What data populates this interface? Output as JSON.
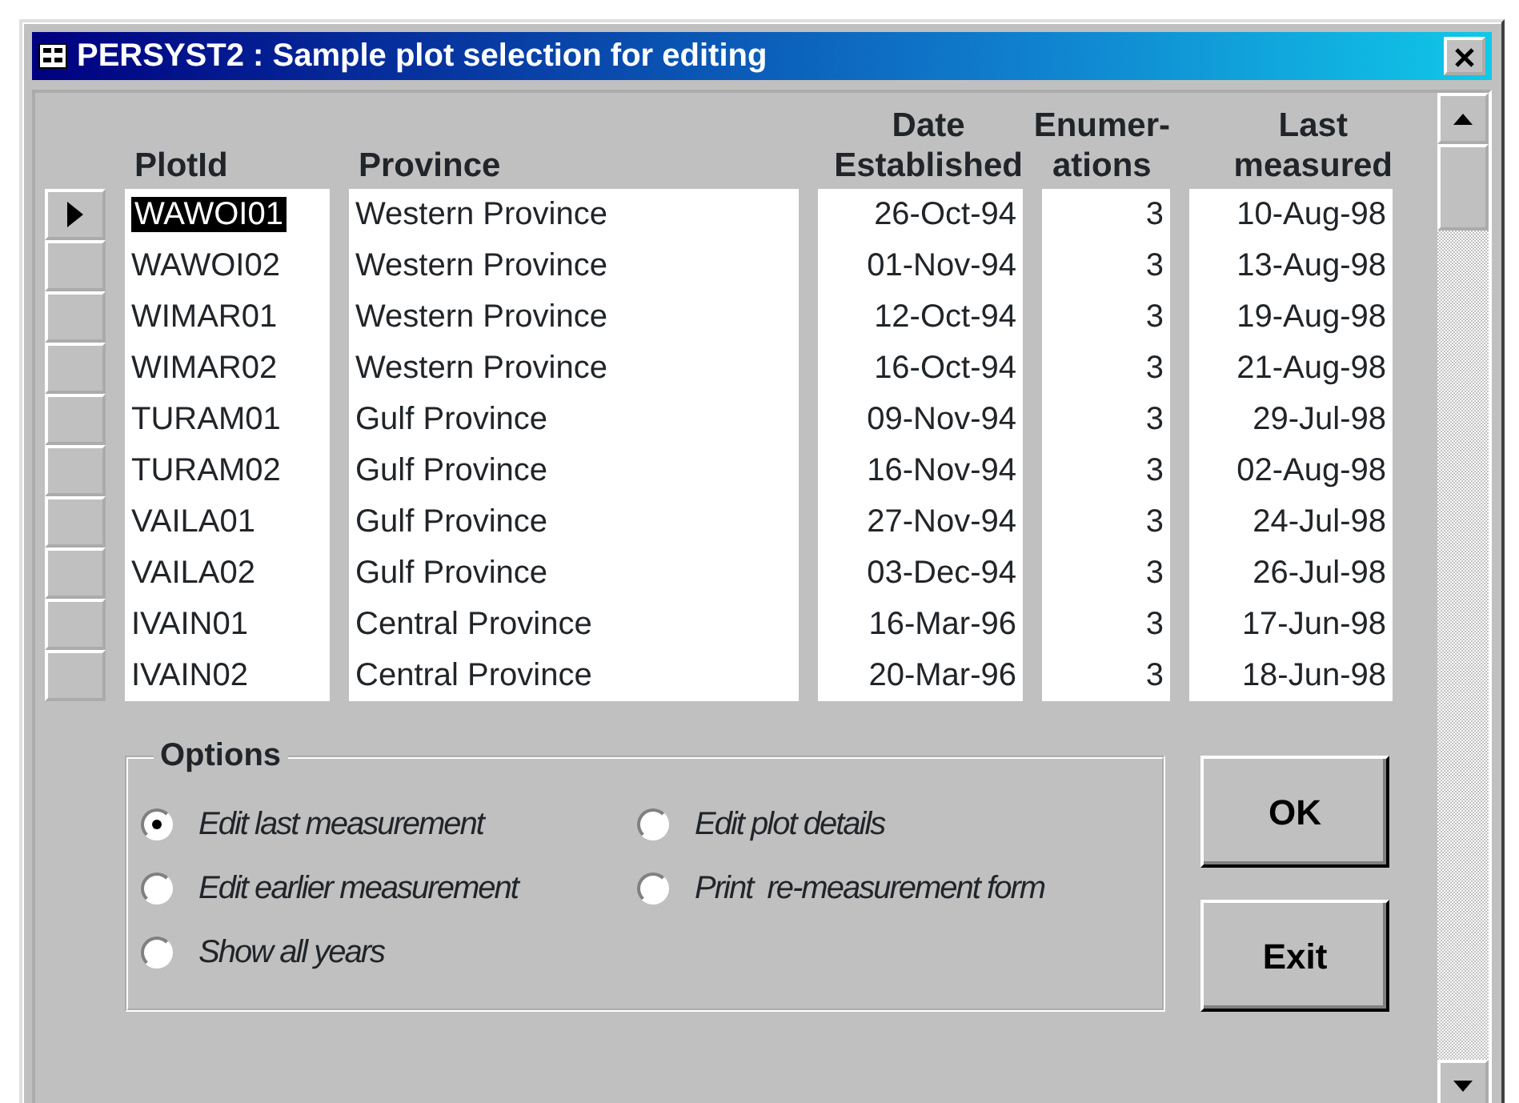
{
  "window": {
    "title": "PERSYST2 : Sample plot selection for editing"
  },
  "table": {
    "columns": [
      {
        "label": "PlotId"
      },
      {
        "label": "Province"
      },
      {
        "label": "Date Established"
      },
      {
        "label": "Enumer- ations"
      },
      {
        "label": "Last measured"
      }
    ],
    "rows": [
      {
        "selected": true,
        "cells": [
          "WAWOI01",
          "Western Province",
          "26-Oct-94",
          "3",
          "10-Aug-98"
        ]
      },
      {
        "selected": false,
        "cells": [
          "WAWOI02",
          "Western Province",
          "01-Nov-94",
          "3",
          "13-Aug-98"
        ]
      },
      {
        "selected": false,
        "cells": [
          "WIMAR01",
          "Western Province",
          "12-Oct-94",
          "3",
          "19-Aug-98"
        ]
      },
      {
        "selected": false,
        "cells": [
          "WIMAR02",
          "Western Province",
          "16-Oct-94",
          "3",
          "21-Aug-98"
        ]
      },
      {
        "selected": false,
        "cells": [
          "TURAM01",
          "Gulf Province",
          "09-Nov-94",
          "3",
          "29-Jul-98"
        ]
      },
      {
        "selected": false,
        "cells": [
          "TURAM02",
          "Gulf Province",
          "16-Nov-94",
          "3",
          "02-Aug-98"
        ]
      },
      {
        "selected": false,
        "cells": [
          "VAILA01",
          "Gulf Province",
          "27-Nov-94",
          "3",
          "24-Jul-98"
        ]
      },
      {
        "selected": false,
        "cells": [
          "VAILA02",
          "Gulf Province",
          "03-Dec-94",
          "3",
          "26-Jul-98"
        ]
      },
      {
        "selected": false,
        "cells": [
          "IVAIN01",
          "Central Province",
          "16-Mar-96",
          "3",
          "17-Jun-98"
        ]
      },
      {
        "selected": false,
        "cells": [
          "IVAIN02",
          "Central Province",
          "20-Mar-96",
          "3",
          "18-Jun-98"
        ]
      }
    ]
  },
  "options": {
    "title": "Options",
    "items": [
      {
        "label": "Edit last measurement",
        "selected": true
      },
      {
        "label": "Edit plot details",
        "selected": false
      },
      {
        "label": "Edit earlier measurement",
        "selected": false
      },
      {
        "label": "Print  re-measurement form",
        "selected": false
      },
      {
        "label": "Show all years",
        "selected": false
      }
    ]
  },
  "buttons": [
    "OK",
    "Exit"
  ]
}
